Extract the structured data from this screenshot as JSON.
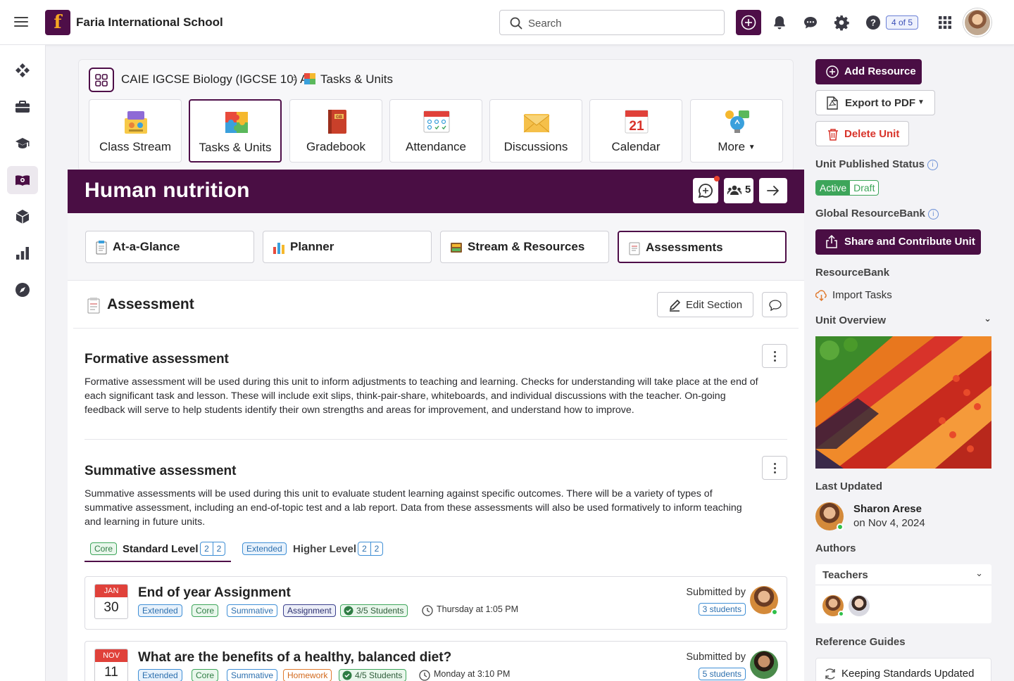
{
  "topbar": {
    "school_name": "Faria International School",
    "logo_letter": "f",
    "search_placeholder": "Search",
    "page_count": "4 of 5"
  },
  "breadcrumb": {
    "course": "CAIE IGCSE Biology (IGCSE 10) A",
    "separator": ">",
    "page": "Tasks & Units"
  },
  "modules": [
    {
      "label": "Class Stream",
      "icon": "class-stream-icon"
    },
    {
      "label": "Tasks & Units",
      "icon": "puzzle-icon"
    },
    {
      "label": "Gradebook",
      "icon": "gradebook-icon"
    },
    {
      "label": "Attendance",
      "icon": "attendance-icon"
    },
    {
      "label": "Discussions",
      "icon": "envelope-icon"
    },
    {
      "label": "Calendar",
      "icon": "calendar-icon",
      "day": "21"
    },
    {
      "label": "More",
      "icon": "lightbulb-icon"
    }
  ],
  "unit": {
    "title": "Human nutrition",
    "students_count": "5"
  },
  "subtabs": [
    "At-a-Glance",
    "Planner",
    "Stream & Resources",
    "Assessments"
  ],
  "section": {
    "title": "Assessment",
    "edit_label": "Edit Section"
  },
  "formative": {
    "heading": "Formative assessment",
    "lines": [
      "Formative assessment will be used during this unit to inform adjustments to teaching and learning. Checks for understanding will take place at the end of",
      "each significant task and lesson. These will include exit slips, think-pair-share, whiteboards, and individual discussions with the teacher. On-going",
      "feedback will serve to help students identify their own strengths and areas for improvement, and understand how to improve."
    ]
  },
  "summative": {
    "heading": "Summative assessment",
    "lines": [
      "Summative assessments will be used during this unit to evaluate student learning against specific outcomes. There will be a variety of types of",
      "summative assessment, including an end-of-topic test and a lab report. Data from these assessments will also be used formatively to inform teaching",
      "and learning in future units."
    ]
  },
  "levels": [
    {
      "tag": "Core",
      "label": "Standard Level",
      "counts": [
        "2",
        "2"
      ]
    },
    {
      "tag": "Extended",
      "label": "Higher Level",
      "counts": [
        "2",
        "2"
      ]
    }
  ],
  "tasks": [
    {
      "month": "JAN",
      "day": "30",
      "title": "End of year Assignment",
      "tags": [
        "Extended",
        "Core",
        "Summative",
        "Assignment"
      ],
      "students": "3/5 Students",
      "time": "Thursday at 1:05 PM",
      "submitted_label": "Submitted by",
      "submitted_count": "3 students"
    },
    {
      "month": "NOV",
      "day": "11",
      "title": "What are the benefits of a healthy, balanced diet?",
      "tags": [
        "Extended",
        "Core",
        "Summative",
        "Homework"
      ],
      "students": "4/5 Students",
      "time": "Monday at 3:10 PM",
      "submitted_label": "Submitted by",
      "submitted_count": "5 students"
    }
  ],
  "sidebar": {
    "add_resource": "Add Resource",
    "export_pdf": "Export to PDF",
    "delete_unit": "Delete Unit",
    "published_status_label": "Unit Published Status",
    "status_active": "Active",
    "status_draft": "Draft",
    "global_rb_label": "Global ResourceBank",
    "share_contribute": "Share and Contribute Unit",
    "resourcebank_label": "ResourceBank",
    "import_tasks": "Import Tasks",
    "unit_overview": "Unit Overview",
    "last_updated_label": "Last Updated",
    "updated_by": "Sharon Arese",
    "updated_on": "on Nov 4, 2024",
    "authors_label": "Authors",
    "teachers_label": "Teachers",
    "reference_guides_label": "Reference Guides",
    "guide_1": "Keeping Standards Updated"
  },
  "colors": {
    "brand": "#4a0e44",
    "accent_green": "#3da55a",
    "accent_blue": "#3f8fd6",
    "danger": "#d8332a"
  }
}
